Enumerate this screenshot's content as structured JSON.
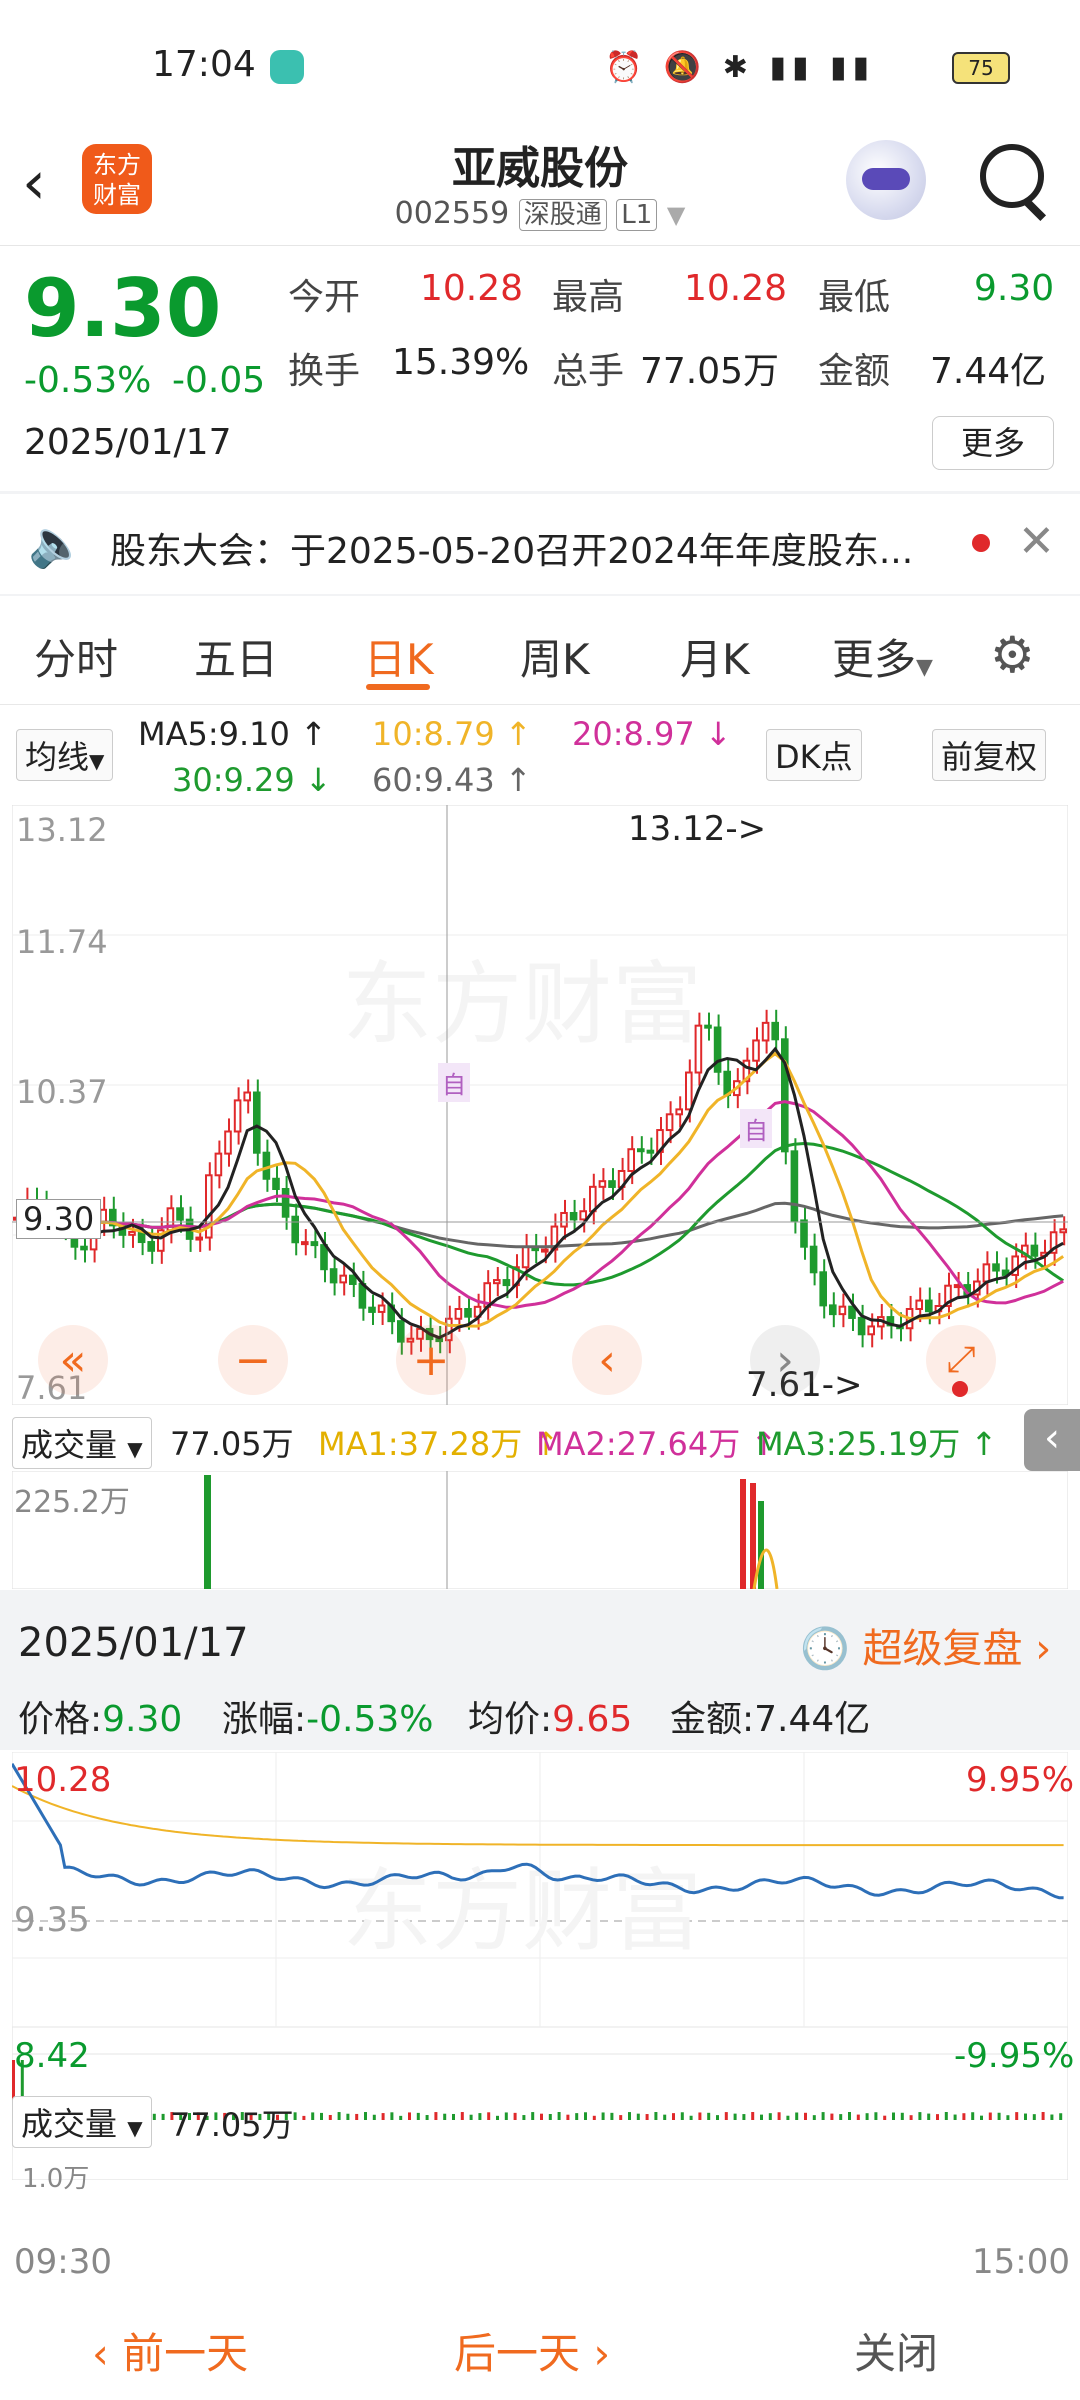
{
  "status": {
    "time": "17:04",
    "battery": "75"
  },
  "header": {
    "title": "亚威股份",
    "code": "002559",
    "exchange_tag": "深股通",
    "level_tag": "L1",
    "logo_line1": "东方",
    "logo_line2": "财富"
  },
  "quote": {
    "price": "9.30",
    "change_pct": "-0.53%",
    "change": "-0.05",
    "date": "2025/01/17",
    "open_label": "今开",
    "open": "10.28",
    "high_label": "最高",
    "high": "10.28",
    "low_label": "最低",
    "low": "9.30",
    "turnover_label": "换手",
    "turnover": "15.39%",
    "volume_label": "总手",
    "volume": "77.05万",
    "amount_label": "金额",
    "amount": "7.44亿",
    "more_label": "更多"
  },
  "notice": {
    "text": "股东大会：于2025-05-20召开2024年年度股东..."
  },
  "tabs": [
    "分时",
    "五日",
    "日K",
    "周K",
    "月K",
    "更多"
  ],
  "active_tab": 2,
  "ma_legend": {
    "selector": "均线",
    "ma5": "MA5:9.10",
    "ma10": "10:8.79",
    "ma20": "20:8.97",
    "ma30": "30:9.29",
    "ma60": "60:9.43",
    "dk_label": "DK点",
    "adjust_label": "前复权"
  },
  "kline": {
    "price_axis": [
      "13.12",
      "11.74",
      "10.37",
      "9.30",
      "7.61"
    ],
    "max_annotation": "13.12->",
    "min_annotation": "7.61->",
    "marker_label": "自"
  },
  "volume_legend": {
    "selector": "成交量",
    "vol": "77.05万",
    "ma1": "MA1:37.28万",
    "ma2": "MA2:27.64万",
    "ma3": "MA3:25.19万",
    "axis_max": "225.2万"
  },
  "popup": {
    "date": "2025/01/17",
    "super_review": "超级复盘",
    "price_label": "价格:",
    "price": "9.30",
    "chg_label": "涨幅:",
    "chg": "-0.53%",
    "avg_label": "均价:",
    "avg": "9.65",
    "amt_label": "金额:",
    "amt": "7.44亿",
    "axis_top": "10.28",
    "axis_mid": "9.35",
    "axis_bot": "8.42",
    "pct_top": "9.95%",
    "pct_bot": "-9.95%",
    "vol_selector": "成交量",
    "vol": "77.05万",
    "vol_axis": "1.0万",
    "time_start": "09:30",
    "time_end": "15:00"
  },
  "bottom": {
    "prev": "前一天",
    "next": "后一天",
    "close": "关闭"
  },
  "colors": {
    "up": "#e0292b",
    "down": "#0a9a2e",
    "ma5": "#222222",
    "ma10": "#f0b428",
    "ma20": "#d0309a",
    "ma30": "#1e9a2e",
    "ma60": "#666666",
    "accent": "#f06a1f"
  }
}
